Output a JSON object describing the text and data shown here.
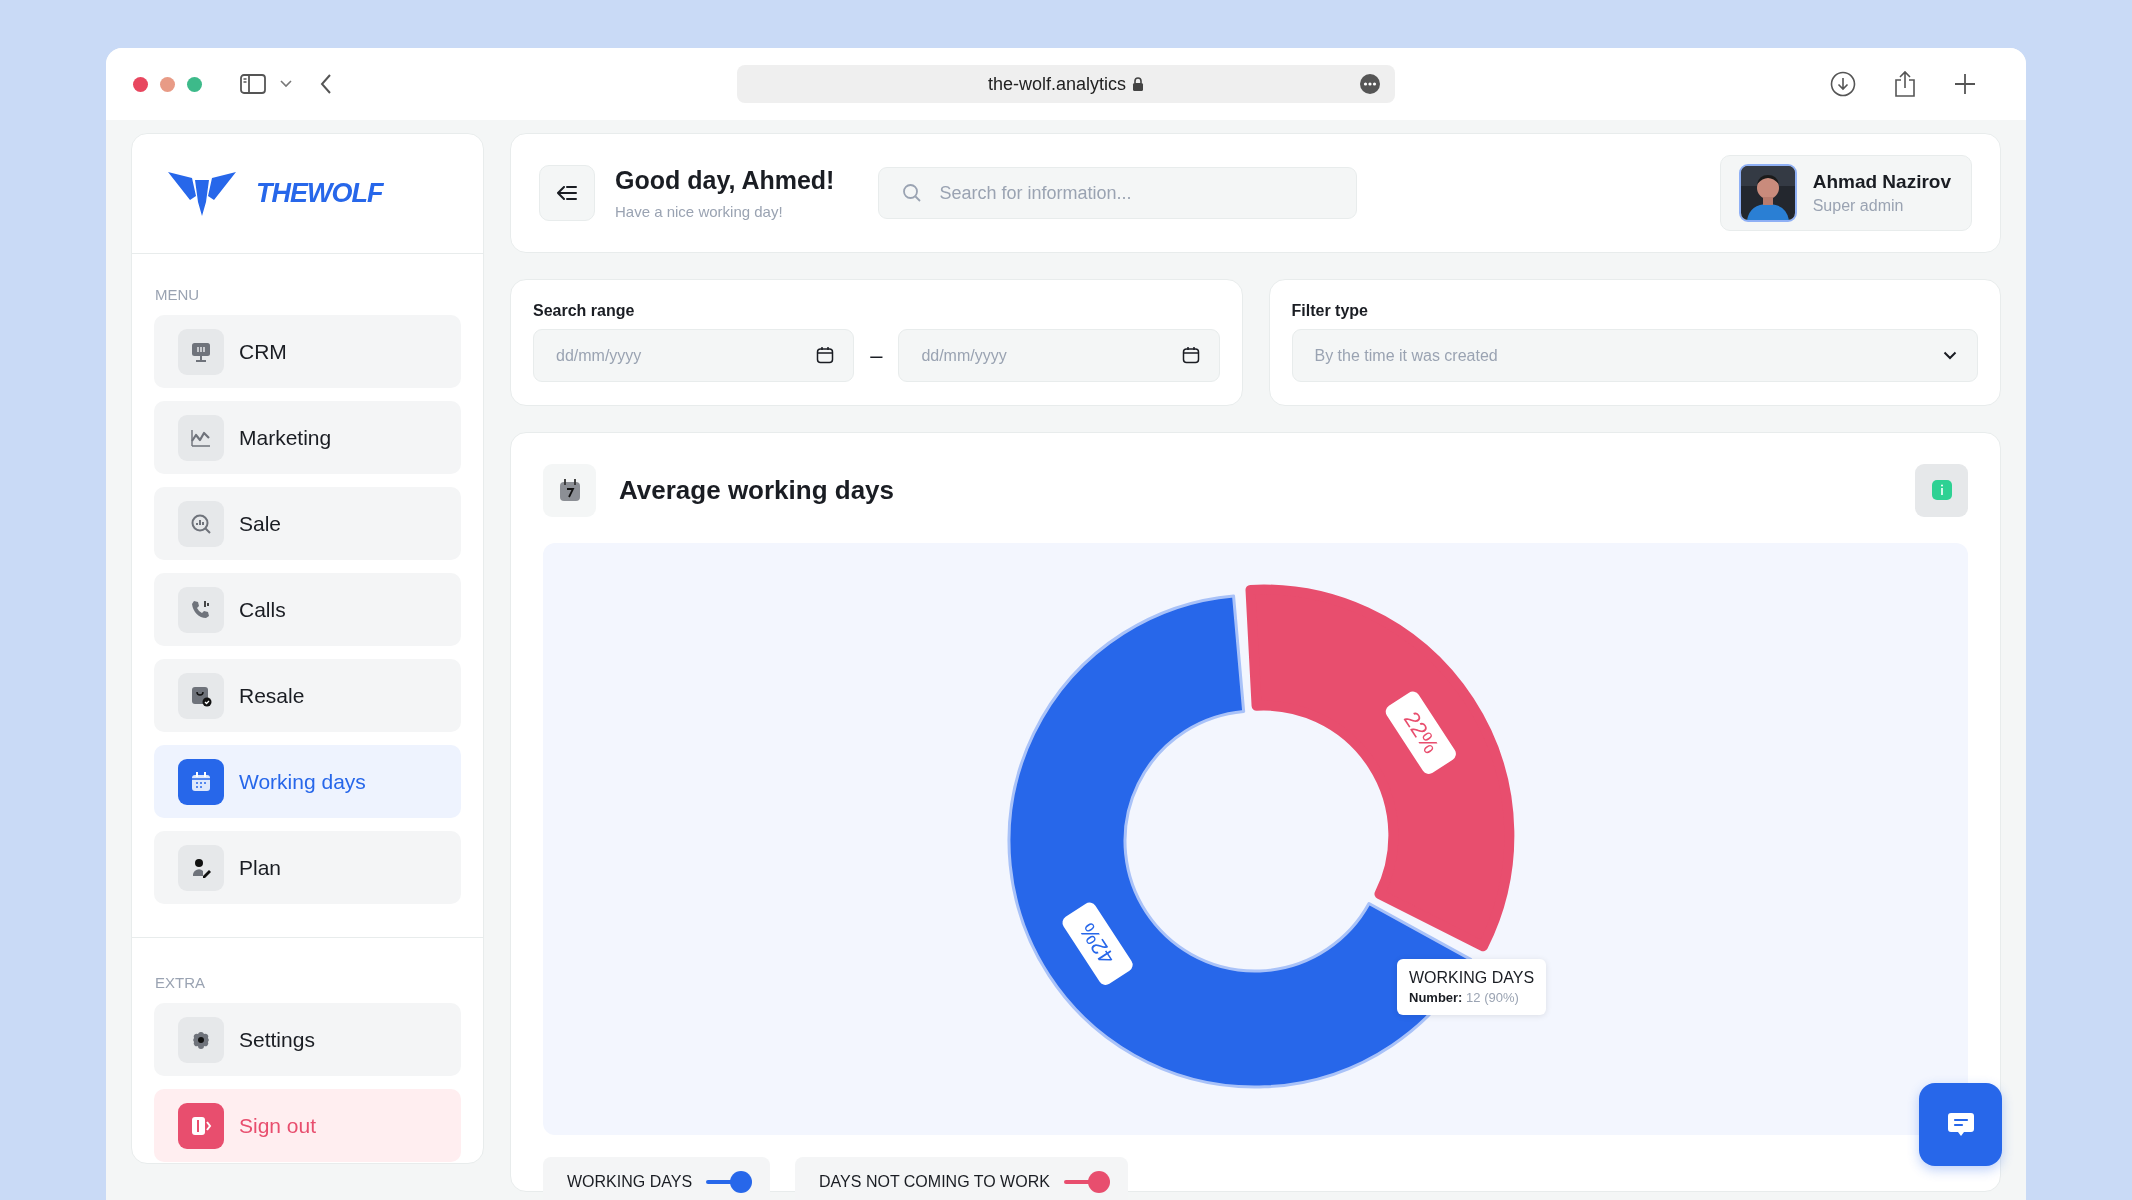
{
  "browser": {
    "url": "the-wolf.analytics"
  },
  "sidebar": {
    "logo": "THEWOLF",
    "sections": [
      {
        "title": "MENU",
        "items": [
          {
            "label": "CRM",
            "selected": false,
            "kind": "normal"
          },
          {
            "label": "Marketing",
            "selected": false,
            "kind": "normal"
          },
          {
            "label": "Sale",
            "selected": false,
            "kind": "normal"
          },
          {
            "label": "Calls",
            "selected": false,
            "kind": "normal"
          },
          {
            "label": "Resale",
            "selected": false,
            "kind": "normal"
          },
          {
            "label": "Working days",
            "selected": true,
            "kind": "normal"
          },
          {
            "label": "Plan",
            "selected": false,
            "kind": "normal"
          }
        ]
      },
      {
        "title": "EXTRA",
        "items": [
          {
            "label": "Settings",
            "selected": false,
            "kind": "normal"
          },
          {
            "label": "Sign out",
            "selected": false,
            "kind": "danger"
          }
        ]
      }
    ]
  },
  "header": {
    "greeting": "Good day, Ahmed!",
    "subtitle": "Have a nice working day!",
    "search": {
      "placeholder": "Search for information..."
    },
    "user": {
      "name": "Ahmad Nazirov",
      "role": "Super admin"
    }
  },
  "filters": {
    "range": {
      "label": "Search range",
      "from": {
        "placeholder": "dd/mm/yyyy"
      },
      "separator": "–",
      "to": {
        "placeholder": "dd/mm/yyyy"
      }
    },
    "type": {
      "label": "Filter type",
      "placeholder": "By the time it was created"
    }
  },
  "chart_card": {
    "title": "Average working days",
    "chart_data": {
      "type": "donut",
      "categories": [
        "WORKING DAYS",
        "DAYS NOT COMING TO WORK"
      ],
      "values": [
        42,
        22
      ],
      "value_labels": [
        "42%",
        "22%"
      ]
    },
    "tooltip": {
      "title": "WORKING DAYS",
      "label": "Number:",
      "value": "12 (90%)"
    },
    "legend": [
      {
        "color": "#2767ea",
        "on": true
      },
      {
        "color": "#e84e6e",
        "on": true
      }
    ]
  }
}
